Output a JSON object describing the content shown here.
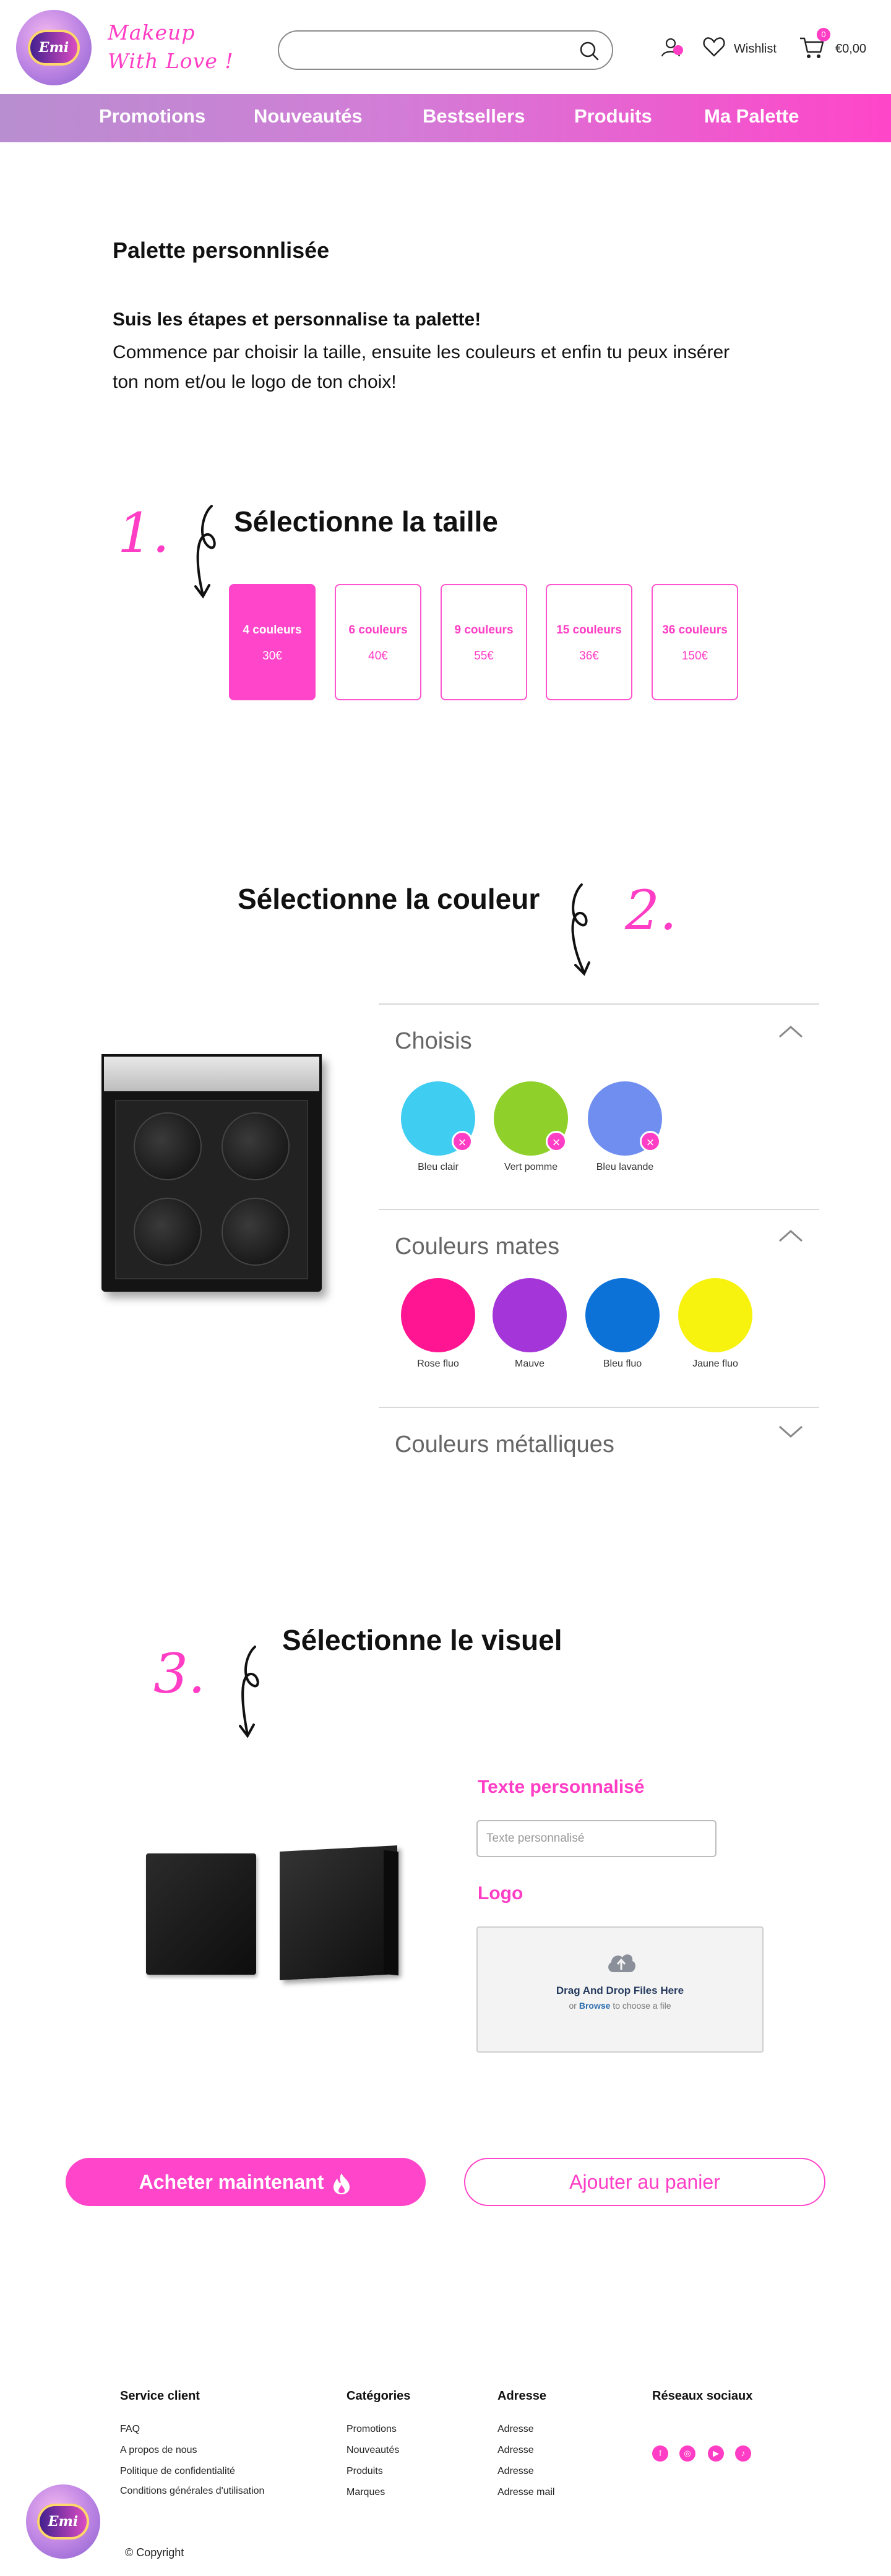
{
  "header": {
    "logo_text": "Emi",
    "brand_line1": "Makeup",
    "brand_line2": "With Love !",
    "search_placeholder": "",
    "wishlist_label": "Wishlist",
    "cart_count": "0",
    "cart_total": "€0,00"
  },
  "nav": {
    "items": [
      "Promotions",
      "Nouveautés",
      "Bestsellers",
      "Produits",
      "Ma Palette"
    ]
  },
  "intro": {
    "title": "Palette personnlisée",
    "bold": "Suis les étapes et personnalise ta palette!",
    "text": "Commence par choisir la taille, ensuite les couleurs et enfin tu peux insérer ton nom et/ou le logo de ton choix!"
  },
  "step1": {
    "number": "1.",
    "title": "Sélectionne la taille",
    "sizes": [
      {
        "count": "4 couleurs",
        "price": "30€",
        "active": true
      },
      {
        "count": "6 couleurs",
        "price": "40€",
        "active": false
      },
      {
        "count": "9 couleurs",
        "price": "55€",
        "active": false
      },
      {
        "count": "15 couleurs",
        "price": "36€",
        "active": false
      },
      {
        "count": "36 couleurs",
        "price": "150€",
        "active": false
      }
    ]
  },
  "step2": {
    "number": "2.",
    "title": "Sélectionne la couleur",
    "chosen": {
      "title": "Choisis",
      "expanded": true,
      "swatches": [
        {
          "name": "Bleu clair",
          "color": "#3fcdf2"
        },
        {
          "name": "Vert pomme",
          "color": "#8fd12a"
        },
        {
          "name": "Bleu lavande",
          "color": "#6f8ef0"
        }
      ]
    },
    "mates": {
      "title": "Couleurs mates",
      "expanded": true,
      "swatches": [
        {
          "name": "Rose fluo",
          "color": "#ff1592"
        },
        {
          "name": "Mauve",
          "color": "#a435d8"
        },
        {
          "name": "Bleu fluo",
          "color": "#0c72d8"
        },
        {
          "name": "Jaune fluo",
          "color": "#f7f20e"
        }
      ]
    },
    "metal": {
      "title": "Couleurs métalliques",
      "expanded": false
    }
  },
  "step3": {
    "number": "3.",
    "title": "Sélectionne le visuel",
    "text_label": "Texte personnalisé",
    "text_placeholder": "Texte personnalisé",
    "logo_label": "Logo",
    "dropzone_title": "Drag And Drop Files Here",
    "dropzone_or": "or",
    "dropzone_browse": "Browse",
    "dropzone_rest": "to choose a file"
  },
  "actions": {
    "buy": "Acheter maintenant",
    "add_cart": "Ajouter au panier"
  },
  "footer": {
    "service": {
      "title": "Service client",
      "links": [
        "FAQ",
        "A propos de nous",
        "Politique de confidentialité",
        "Conditions générales d'utilisation"
      ]
    },
    "categories": {
      "title": "Catégories",
      "links": [
        "Promotions",
        "Nouveautés",
        "Produits",
        "Marques"
      ]
    },
    "address": {
      "title": "Adresse",
      "links": [
        "Adresse",
        "Adresse",
        "Adresse",
        "Adresse mail"
      ]
    },
    "social": {
      "title": "Réseaux sociaux",
      "icons": [
        "facebook-icon",
        "instagram-icon",
        "youtube-icon",
        "tiktok-icon"
      ]
    },
    "copyright": "© Copyright"
  },
  "colors": {
    "accent": "#ff3dc5",
    "nav_start": "#b88ed0",
    "nav_end": "#ff45c9"
  }
}
